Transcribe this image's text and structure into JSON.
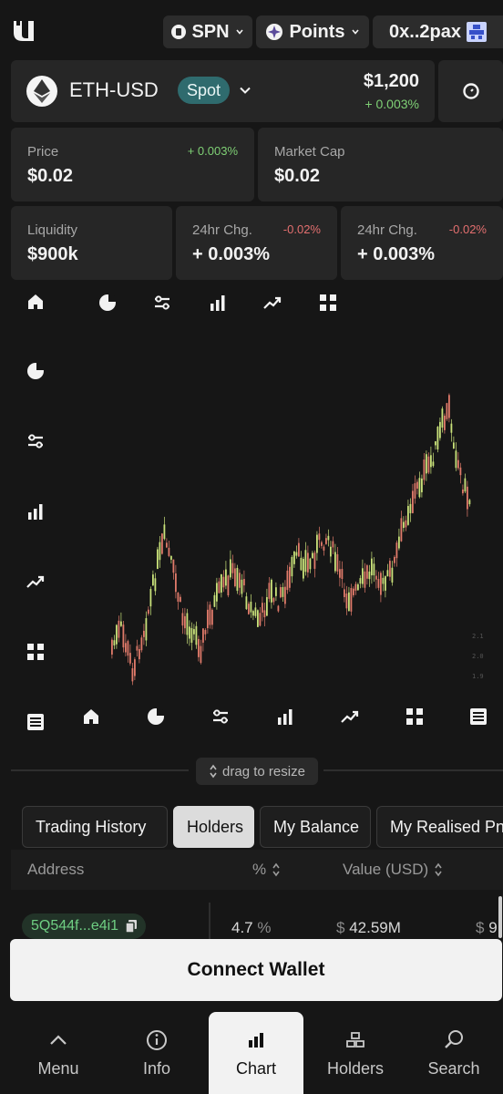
{
  "header": {
    "network_label": "SPN",
    "points_label": "Points",
    "wallet_label": "0x..2pax"
  },
  "pair": {
    "name": "ETH-USD",
    "badge": "Spot",
    "price": "$1,200",
    "change": "+ 0.003%"
  },
  "stats": [
    {
      "label": "Price",
      "value": "$0.02",
      "change": "+ 0.003%"
    },
    {
      "label": "Market Cap",
      "value": "$0.02",
      "change": ""
    },
    {
      "label": "Liquidity",
      "value": "$900k",
      "change": ""
    },
    {
      "label": "24hr Chg.",
      "value": "+ 0.003%",
      "change": "-0.02%"
    },
    {
      "label": "24hr Chg.",
      "value": "+ 0.003%",
      "change": "-0.02%"
    }
  ],
  "chart_toolbar_icons": [
    "home-icon",
    "pie-chart-icon",
    "sliders-icon",
    "bar-chart-icon",
    "trend-icon",
    "grid-icon",
    "list-icon"
  ],
  "axis_labels": [
    "2.1",
    "2.0",
    "1.9"
  ],
  "resize_label": "drag to resize",
  "tabs": [
    {
      "label": "Trading History"
    },
    {
      "label": "Holders"
    },
    {
      "label": "My Balance"
    },
    {
      "label": "My Realised Pn"
    }
  ],
  "table": {
    "headers": {
      "address": "Address",
      "percent": "%",
      "value": "Value (USD)"
    },
    "row": {
      "address": "5Q544f...e4i1",
      "percent": "4.7",
      "percent_sign": "%",
      "currency": "$",
      "value": "42.59M",
      "extra_currency": "$",
      "extra": "9"
    }
  },
  "connect_label": "Connect Wallet",
  "nav": [
    {
      "label": "Menu",
      "icon": "chevron-up-icon"
    },
    {
      "label": "Info",
      "icon": "info-icon"
    },
    {
      "label": "Chart",
      "icon": "bar-chart-icon"
    },
    {
      "label": "Holders",
      "icon": "holders-icon"
    },
    {
      "label": "Search",
      "icon": "search-icon"
    }
  ],
  "colors": {
    "up": "#c9e27a",
    "down": "#e07a6a",
    "badge": "#2f6b6e",
    "positive": "#7fd075",
    "negative": "#e36f6f"
  }
}
